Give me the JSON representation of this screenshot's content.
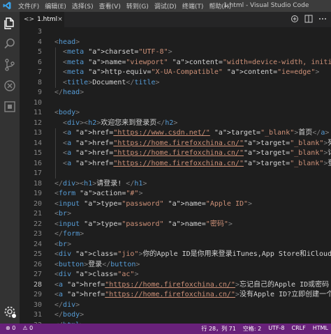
{
  "titlebar": {
    "menu": [
      "文件(F)",
      "编辑(E)",
      "选择(S)",
      "查看(V)",
      "转到(G)",
      "调试(D)",
      "终端(T)",
      "帮助(H)"
    ],
    "window_title": "1.html - Visual Studio Code"
  },
  "tab": {
    "label": "1.html"
  },
  "editor": {
    "line_numbers": [
      "3",
      "4",
      "5",
      "6",
      "7",
      "8",
      "9",
      "10",
      "11",
      "12",
      "13",
      "14",
      "15",
      "16",
      "17",
      "18",
      "19",
      "20",
      "21",
      "22",
      "23",
      "24",
      "25",
      "26",
      "27",
      "28",
      "29",
      "30",
      "31",
      "32"
    ],
    "active_line": "28",
    "lines": [
      "",
      "<head>",
      "  <meta charset=\"UTF-8\">",
      "  <meta name=\"viewport\" content=\"width=device-width, initial-sc",
      "  <meta http-equiv=\"X-UA-Compatible\" content=\"ie=edge\">",
      "  <title>Document</title>",
      "</head>",
      "",
      "<body>",
      "  <div><h2>欢迎您来到登录页</h2>",
      "  <a href=\"https://www.csdn.net/\" target=\"_blank\">首页</a>",
      "  <a href=\"https://home.firefoxchina.cn/\"target=\"_blank\">列表页</a>",
      "  <a href=\"https://home.firefoxchina.cn/\"target=\"_blank\">详情页</a>",
      "  <a href=\"https://home.firefoxchina.cn/\"target=\"_blank\">登录页</a>",
      "",
      "</div><h1>请登录! </h1>",
      "<form action=\"#\">",
      "<input type=\"password\" name=\"Apple ID\">",
      "<br>",
      "<input type=\"password\" name=\"密码\">",
      "</form>",
      "<br>",
      "<div class=\"jio\">你的Apple ID是你用来登录iTunes,App Store和iCloud",
      "<button>登录</button>",
      "<div class=\"ac\">",
      "<a href=\"https://home.firefoxchina.cn/\">忘记自己的Apple ID或密码",
      "<a href=\"https://home.firefoxchina.cn/\">没有Apple ID?立即创建一个",
      "</div>",
      "</body>",
      "</html>"
    ]
  },
  "statusbar": {
    "errors": "0",
    "warnings": "0",
    "position": "行 28，列 71",
    "spaces": "空格: 2",
    "encoding": "UTF-8",
    "eol": "CRLF",
    "language": "HTML"
  },
  "colors": {
    "statusbar": "#68217a",
    "background": "#1e1e1e",
    "tag": "#569cd6",
    "attribute": "#9cdcfe",
    "string": "#ce9178"
  }
}
